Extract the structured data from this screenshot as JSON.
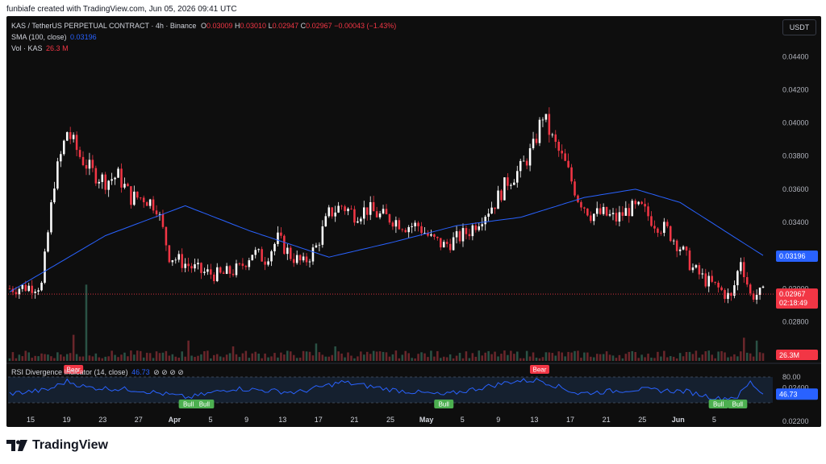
{
  "topline": "funbiafe created with TradingView.com, Jun 05, 2026 09:41 UTC",
  "legend": {
    "symbol": "KAS / TetherUS PERPETUAL CONTRACT · 4h · Binance",
    "O_label": "O",
    "O": "0.03009",
    "H_label": "H",
    "H": "0.03010",
    "L_label": "L",
    "L": "0.02947",
    "C_label": "C",
    "C": "0.02967",
    "change": "−0.00043 (−1.43%)",
    "sma_label": "SMA (100, close)",
    "sma_value": "0.03196",
    "vol_label": "Vol · KAS",
    "vol_value": "26.3 M"
  },
  "currency_button": "USDT",
  "price_axis": [
    "0.04400",
    "0.04200",
    "0.04000",
    "0.03800",
    "0.03600",
    "0.03400",
    "0.03000",
    "0.02800",
    "0.02600",
    "0.02400",
    "0.02200"
  ],
  "price_badges": {
    "sma": "0.03196",
    "last": "0.02967",
    "countdown": "02:18:49",
    "volume": "26.3M"
  },
  "rsi": {
    "label": "RSI Divergence Indicator (14, close)",
    "value": "46.73",
    "icons": "⊘ ⊘ ⊘ ⊘",
    "upper": "80.00",
    "badge": "46.73",
    "markers": [
      {
        "text": "Bear",
        "type": "bear",
        "bar": 20
      },
      {
        "text": "Bull",
        "type": "bull",
        "bar": 56
      },
      {
        "text": "Bull",
        "type": "bull",
        "bar": 61
      },
      {
        "text": "Bull",
        "type": "bull",
        "bar": 136
      },
      {
        "text": "Bear",
        "type": "bear",
        "bar": 166
      },
      {
        "text": "Bull",
        "type": "bull",
        "bar": 222
      },
      {
        "text": "Bull",
        "type": "bull",
        "bar": 228
      }
    ]
  },
  "time_axis": [
    "15",
    "19",
    "23",
    "27",
    "Apr",
    "5",
    "9",
    "13",
    "17",
    "21",
    "25",
    "May",
    "5",
    "9",
    "13",
    "17",
    "21",
    "25",
    "Jun",
    "5"
  ],
  "brand": "TradingView",
  "colors": {
    "up": "#ffffff",
    "down": "#f23645",
    "sma": "#2962ff",
    "rsi": "#2962ff",
    "bull": "#4caf50",
    "bear": "#f23645"
  },
  "chart_data": {
    "type": "candlestick",
    "title": "KAS / TetherUS PERPETUAL CONTRACT · 4h · Binance",
    "ylim": [
      0.027,
      0.0445
    ],
    "x_ticks": [
      "15",
      "19",
      "23",
      "27",
      "Apr",
      "5",
      "9",
      "13",
      "17",
      "21",
      "25",
      "May",
      "5",
      "9",
      "13",
      "17",
      "21",
      "25",
      "Jun",
      "5"
    ],
    "close_anchors": [
      [
        0,
        0.03
      ],
      [
        10,
        0.0302
      ],
      [
        14,
        0.0365
      ],
      [
        18,
        0.0395
      ],
      [
        22,
        0.038
      ],
      [
        26,
        0.037
      ],
      [
        30,
        0.0365
      ],
      [
        34,
        0.0368
      ],
      [
        38,
        0.0355
      ],
      [
        42,
        0.0355
      ],
      [
        46,
        0.035
      ],
      [
        50,
        0.032
      ],
      [
        55,
        0.0315
      ],
      [
        60,
        0.031
      ],
      [
        66,
        0.0308
      ],
      [
        72,
        0.0312
      ],
      [
        76,
        0.0322
      ],
      [
        80,
        0.0318
      ],
      [
        84,
        0.033
      ],
      [
        88,
        0.032
      ],
      [
        92,
        0.0315
      ],
      [
        96,
        0.0325
      ],
      [
        100,
        0.0345
      ],
      [
        104,
        0.035
      ],
      [
        108,
        0.0345
      ],
      [
        112,
        0.0348
      ],
      [
        116,
        0.0344
      ],
      [
        120,
        0.0342
      ],
      [
        124,
        0.0338
      ],
      [
        128,
        0.0338
      ],
      [
        132,
        0.033
      ],
      [
        136,
        0.0326
      ],
      [
        140,
        0.033
      ],
      [
        144,
        0.0335
      ],
      [
        148,
        0.0344
      ],
      [
        152,
        0.0352
      ],
      [
        156,
        0.0365
      ],
      [
        160,
        0.0372
      ],
      [
        164,
        0.0385
      ],
      [
        167,
        0.0405
      ],
      [
        170,
        0.039
      ],
      [
        174,
        0.0375
      ],
      [
        178,
        0.0355
      ],
      [
        182,
        0.0345
      ],
      [
        186,
        0.0345
      ],
      [
        190,
        0.0342
      ],
      [
        194,
        0.0348
      ],
      [
        198,
        0.0348
      ],
      [
        202,
        0.034
      ],
      [
        206,
        0.0335
      ],
      [
        210,
        0.0325
      ],
      [
        214,
        0.0312
      ],
      [
        218,
        0.0305
      ],
      [
        222,
        0.03
      ],
      [
        226,
        0.0294
      ],
      [
        229,
        0.0318
      ],
      [
        232,
        0.0296
      ],
      [
        236,
        0.0297
      ]
    ],
    "sma_100": [
      [
        0,
        0.0298
      ],
      [
        30,
        0.0332
      ],
      [
        55,
        0.035
      ],
      [
        75,
        0.0335
      ],
      [
        100,
        0.0319
      ],
      [
        120,
        0.0328
      ],
      [
        140,
        0.0338
      ],
      [
        160,
        0.0343
      ],
      [
        180,
        0.0355
      ],
      [
        196,
        0.036
      ],
      [
        210,
        0.0352
      ],
      [
        236,
        0.032
      ]
    ],
    "volume_spikes": [
      [
        24,
        26.3
      ],
      [
        20,
        9
      ],
      [
        56,
        7
      ],
      [
        70,
        5
      ],
      [
        96,
        6
      ],
      [
        102,
        5
      ],
      [
        230,
        8
      ],
      [
        234,
        7
      ]
    ],
    "rsi_14": [
      [
        0,
        48
      ],
      [
        12,
        55
      ],
      [
        18,
        72
      ],
      [
        24,
        60
      ],
      [
        40,
        55
      ],
      [
        56,
        40
      ],
      [
        70,
        58
      ],
      [
        90,
        50
      ],
      [
        104,
        70
      ],
      [
        120,
        55
      ],
      [
        136,
        45
      ],
      [
        150,
        62
      ],
      [
        158,
        72
      ],
      [
        166,
        74
      ],
      [
        178,
        48
      ],
      [
        196,
        56
      ],
      [
        212,
        52
      ],
      [
        222,
        38
      ],
      [
        228,
        42
      ],
      [
        232,
        70
      ],
      [
        236,
        47
      ]
    ],
    "last_price": 0.02967,
    "sma_last": 0.03196,
    "rsi_last": 46.73,
    "volume_last": "26.3M"
  }
}
